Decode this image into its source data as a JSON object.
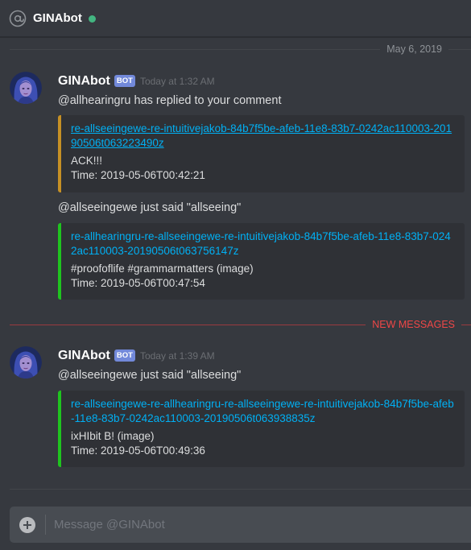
{
  "header": {
    "title": "GINAbot",
    "status_color": "#43b581"
  },
  "date_divider": "May 6, 2019",
  "new_messages_divider": "NEW MESSAGES",
  "messages": [
    {
      "author": "GINAbot",
      "bot_tag": "BOT",
      "timestamp": "Today at 1:32 AM",
      "items": [
        {
          "text": "@allhearingru has replied to your comment",
          "embed": {
            "accent": "#c69025",
            "link": "re-allseeingewe-re-intuitivejakob-84b7f5be-afeb-11e8-83b7-0242ac110003-20190506t063223490z",
            "description": "ACK!!!",
            "time": "Time: 2019-05-06T00:42:21"
          }
        },
        {
          "text": "@allseeingewe just said \"allseeing\"",
          "embed": {
            "accent": "#1fc41f",
            "link": "re-allhearingru-re-allseeingewe-re-intuitivejakob-84b7f5be-afeb-11e8-83b7-0242ac110003-20190506t063756147z",
            "description": "#proofoflife #grammarmatters (image)",
            "time": "Time: 2019-05-06T00:47:54"
          }
        }
      ]
    },
    {
      "author": "GINAbot",
      "bot_tag": "BOT",
      "timestamp": "Today at 1:39 AM",
      "items": [
        {
          "text": "@allseeingewe just said \"allseeing\"",
          "embed": {
            "accent": "#1fc41f",
            "link": "re-allseeingewe-re-allhearingru-re-allseeingewe-re-intuitivejakob-84b7f5be-afeb-11e8-83b7-0242ac110003-20190506t063938835z",
            "description": "ixHIbit B! (image)",
            "time": "Time: 2019-05-06T00:49:36"
          }
        }
      ]
    }
  ],
  "input": {
    "placeholder": "Message @GINAbot",
    "value": ""
  },
  "icons": {
    "header": "at-sign-icon",
    "add": "plus-circle-icon",
    "status": "online-status-icon"
  }
}
